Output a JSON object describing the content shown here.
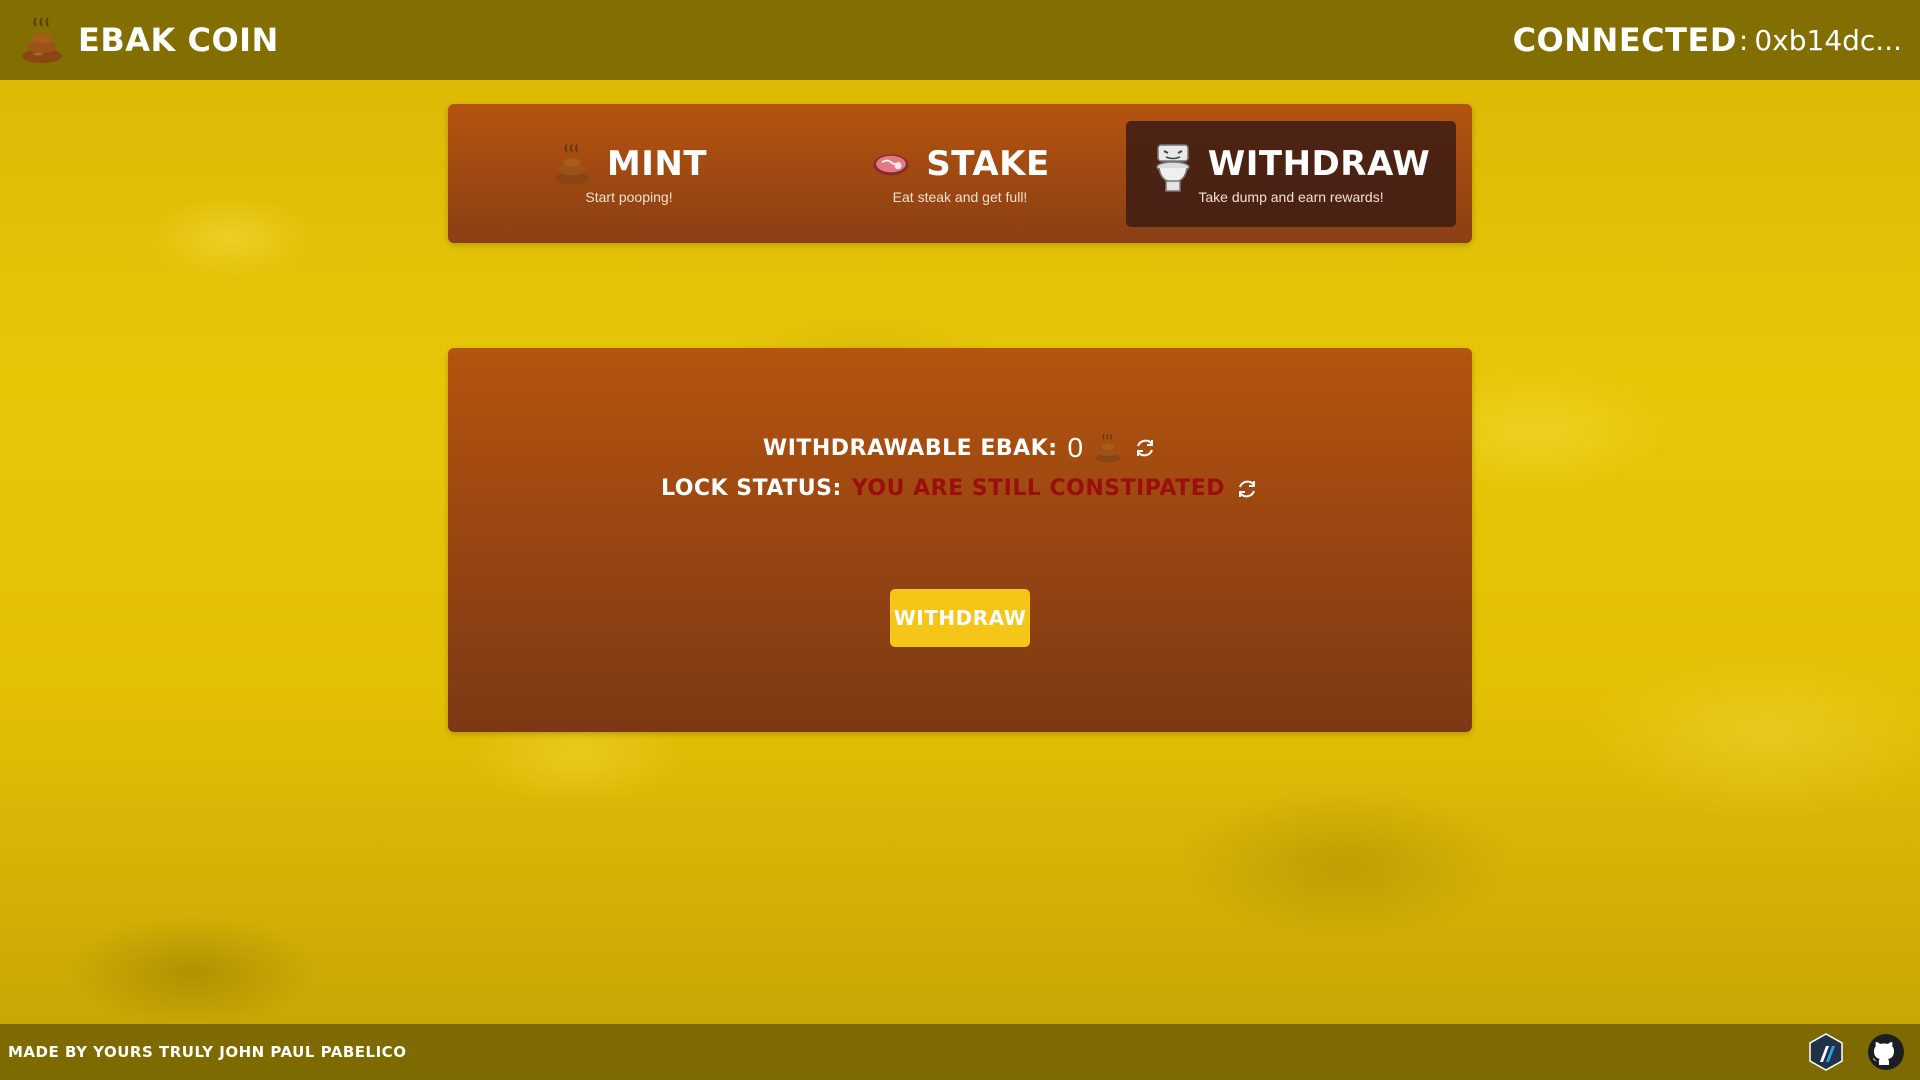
{
  "header": {
    "title": "EBAK COIN",
    "connected_label": "CONNECTED",
    "connected_sep": ":",
    "address": "0xb14dc..."
  },
  "tabs": [
    {
      "label": "MINT",
      "sub": "Start pooping!",
      "icon": "poop-icon"
    },
    {
      "label": "STAKE",
      "sub": "Eat steak and get full!",
      "icon": "steak-icon"
    },
    {
      "label": "WITHDRAW",
      "sub": "Take dump and earn rewards!",
      "icon": "toilet-icon",
      "active": true
    }
  ],
  "withdraw_panel": {
    "withdrawable_label": "WITHDRAWABLE EBAK",
    "label_sep": ":",
    "withdrawable_value": "0",
    "lock_label": "LOCK STATUS",
    "lock_status": "YOU ARE STILL CONSTIPATED",
    "button_label": "WITHDRAW"
  },
  "footer": {
    "credit": "MADE BY YOURS TRULY JOHN PAUL PABELICO",
    "icons": [
      "arbitrum-icon",
      "github-icon"
    ]
  },
  "colors": {
    "panel": "#b5540f",
    "active_tab": "#3c1c14",
    "button": "#f5c518",
    "status_red": "#9a0e0e"
  }
}
